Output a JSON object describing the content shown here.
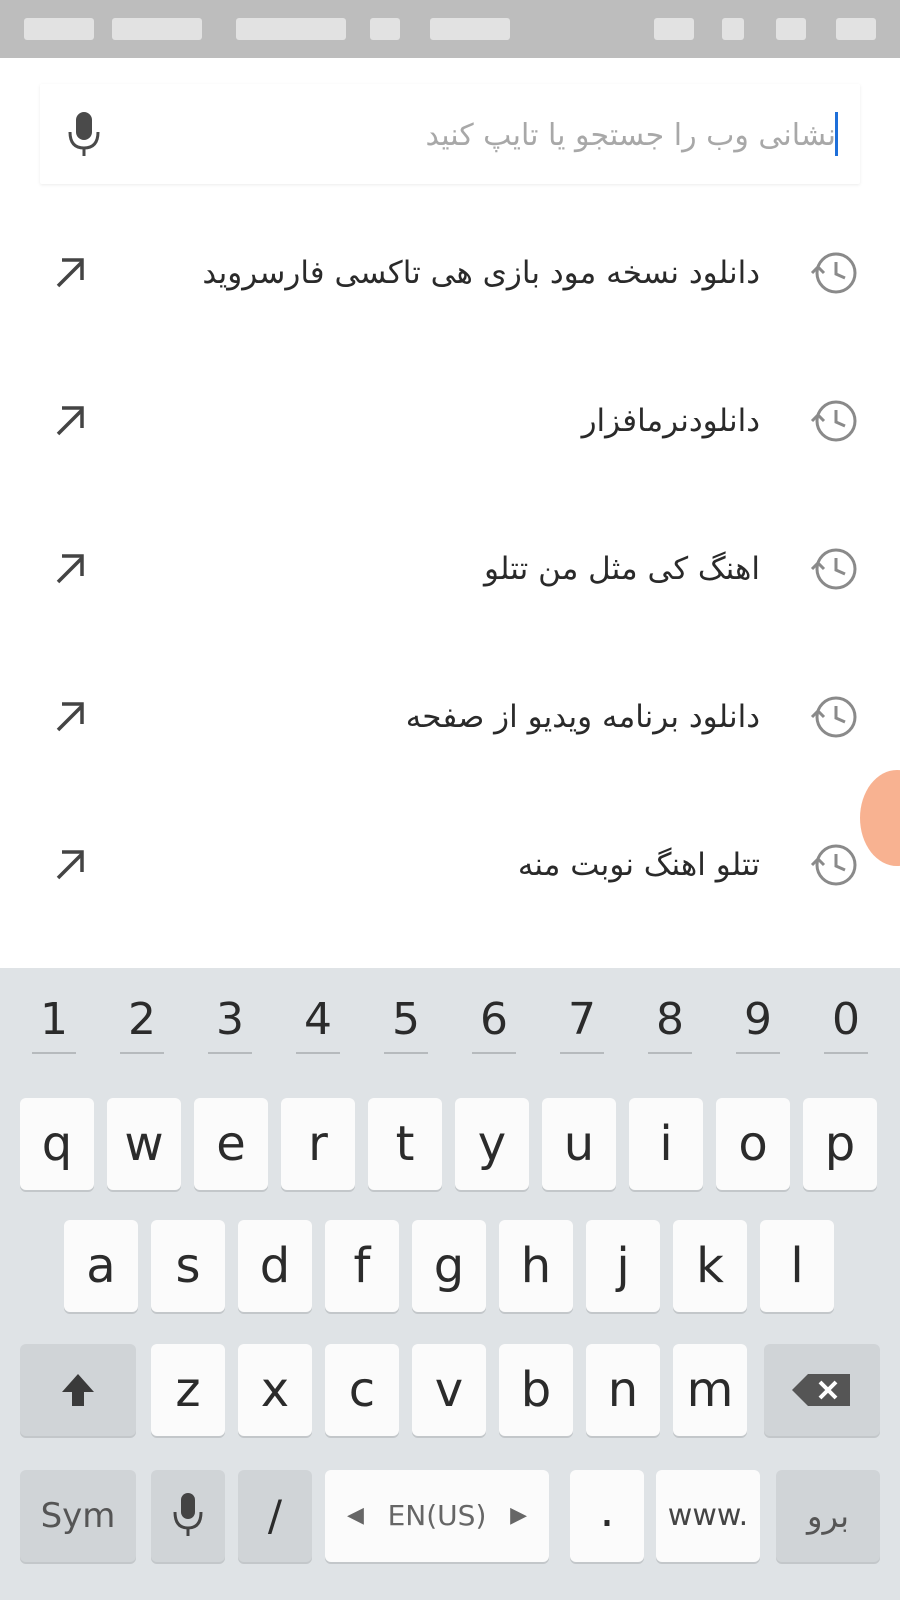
{
  "search": {
    "placeholder": "نشانی وب را جستجو یا تایپ کنید"
  },
  "suggestions": [
    {
      "text": "دانلود نسخه مود بازی هی تاکسی فارسروید"
    },
    {
      "text": "دانلودنرمافزار"
    },
    {
      "text": "اهنگ کی مثل من تتلو"
    },
    {
      "text": "دانلود برنامه ویدیو از صفحه"
    },
    {
      "text": "تتلو اهنگ نوبت منه"
    }
  ],
  "keyboard": {
    "numbers": [
      "1",
      "2",
      "3",
      "4",
      "5",
      "6",
      "7",
      "8",
      "9",
      "0"
    ],
    "row1": [
      "q",
      "w",
      "e",
      "r",
      "t",
      "y",
      "u",
      "i",
      "o",
      "p"
    ],
    "row2": [
      "a",
      "s",
      "d",
      "f",
      "g",
      "h",
      "j",
      "k",
      "l"
    ],
    "row3": [
      "z",
      "x",
      "c",
      "v",
      "b",
      "n",
      "m"
    ],
    "sym_label": "Sym",
    "slash_label": "/",
    "language_label": "EN(US)",
    "period_label": ".",
    "www_label": "www.",
    "go_label": "برو"
  },
  "colors": {
    "status_bar": "#bdbdbd",
    "keyboard_bg": "#dfe3e6",
    "cursor": "#1e6fd9",
    "accent_blob": "#f7a47e"
  }
}
